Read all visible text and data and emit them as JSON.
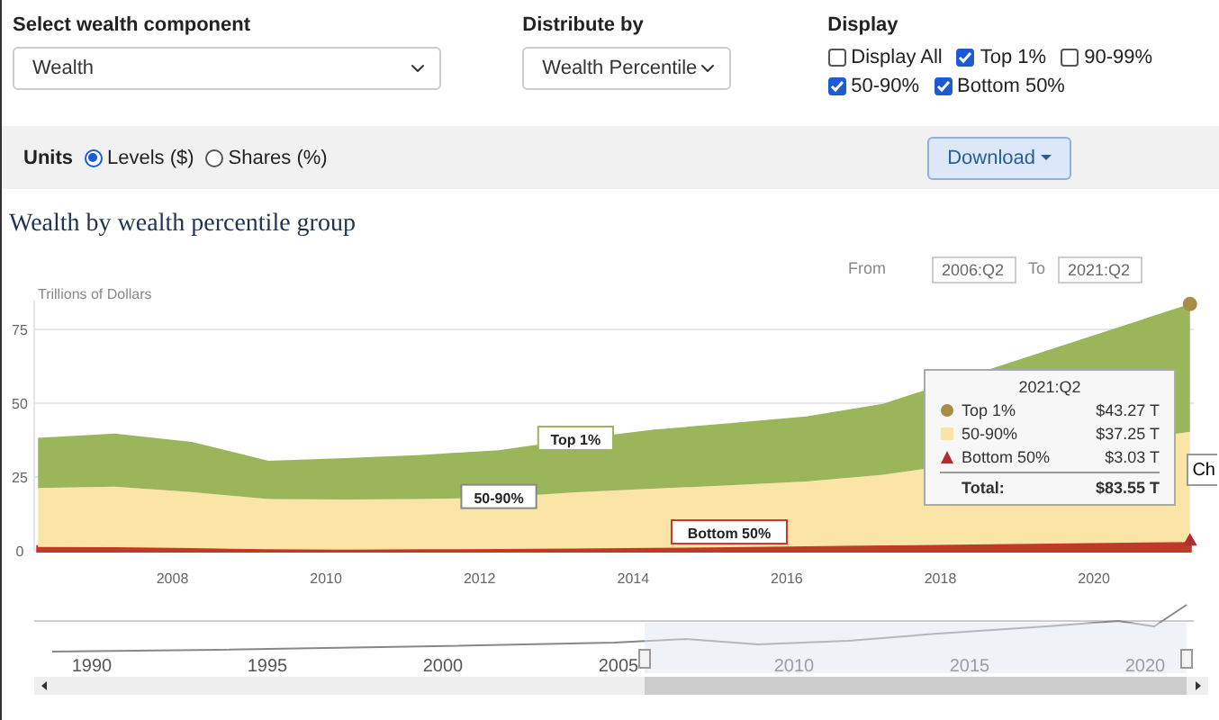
{
  "controls": {
    "component": {
      "label": "Select wealth component",
      "value": "Wealth"
    },
    "distribute": {
      "label": "Distribute by",
      "value": "Wealth Percentile"
    },
    "display": {
      "label": "Display",
      "options": [
        {
          "label": "Display All",
          "checked": false
        },
        {
          "label": "Top 1%",
          "checked": true
        },
        {
          "label": "90-99%",
          "checked": false
        },
        {
          "label": "50-90%",
          "checked": true
        },
        {
          "label": "Bottom 50%",
          "checked": true
        }
      ]
    }
  },
  "units": {
    "label": "Units",
    "options": [
      {
        "label": "Levels ($)",
        "selected": true
      },
      {
        "label": "Shares (%)",
        "selected": false
      }
    ],
    "download": "Download"
  },
  "chart": {
    "title": "Wealth by wealth percentile group",
    "from_label": "From",
    "from": "2006:Q2",
    "to_label": "To",
    "to": "2021:Q2",
    "context_button": "Ch",
    "tooltip": {
      "title": "2021:Q2",
      "rows": [
        {
          "label": "Top 1%",
          "value": "$43.27 T"
        },
        {
          "label": "50-90%",
          "value": "$37.25 T"
        },
        {
          "label": "Bottom 50%",
          "value": "$3.03 T"
        }
      ],
      "total_label": "Total:",
      "total": "$83.55 T"
    },
    "navigator_labels": [
      "1990",
      "1995",
      "2000",
      "2005",
      "2010",
      "2015",
      "2020"
    ],
    "chart_data": {
      "type": "area",
      "stacked": true,
      "ylabel": "Trillions of Dollars",
      "x": [
        2006.25,
        2007.25,
        2008.25,
        2009.25,
        2010.25,
        2011.25,
        2012.25,
        2013.25,
        2014.25,
        2015.25,
        2016.25,
        2017.25,
        2018.25,
        2019.25,
        2020.25,
        2021.25
      ],
      "xticks": [
        2008,
        2010,
        2012,
        2014,
        2016,
        2018,
        2020
      ],
      "yticks": [
        0,
        25,
        50,
        75
      ],
      "xlim": [
        2006.2,
        2021.3
      ],
      "ylim": [
        0,
        85
      ],
      "grid": true,
      "series": [
        {
          "name": "Bottom 50%",
          "color": "#c0392b",
          "values": [
            1.3,
            1.2,
            0.9,
            0.5,
            0.4,
            0.5,
            0.6,
            0.8,
            1.0,
            1.2,
            1.5,
            1.8,
            2.0,
            2.2,
            2.6,
            3.0
          ]
        },
        {
          "name": "50-90%",
          "color": "#fbe5a6",
          "values": [
            20,
            20.5,
            19,
            17,
            17,
            17,
            17.5,
            19,
            20,
            21,
            22,
            24,
            null,
            null,
            null,
            37.3
          ]
        },
        {
          "name": "Top 1%",
          "color": "#9bb55a",
          "values": [
            17,
            18,
            17,
            13,
            14,
            15,
            16,
            18,
            20,
            21,
            22,
            24,
            null,
            null,
            null,
            43.3
          ]
        }
      ]
    }
  }
}
